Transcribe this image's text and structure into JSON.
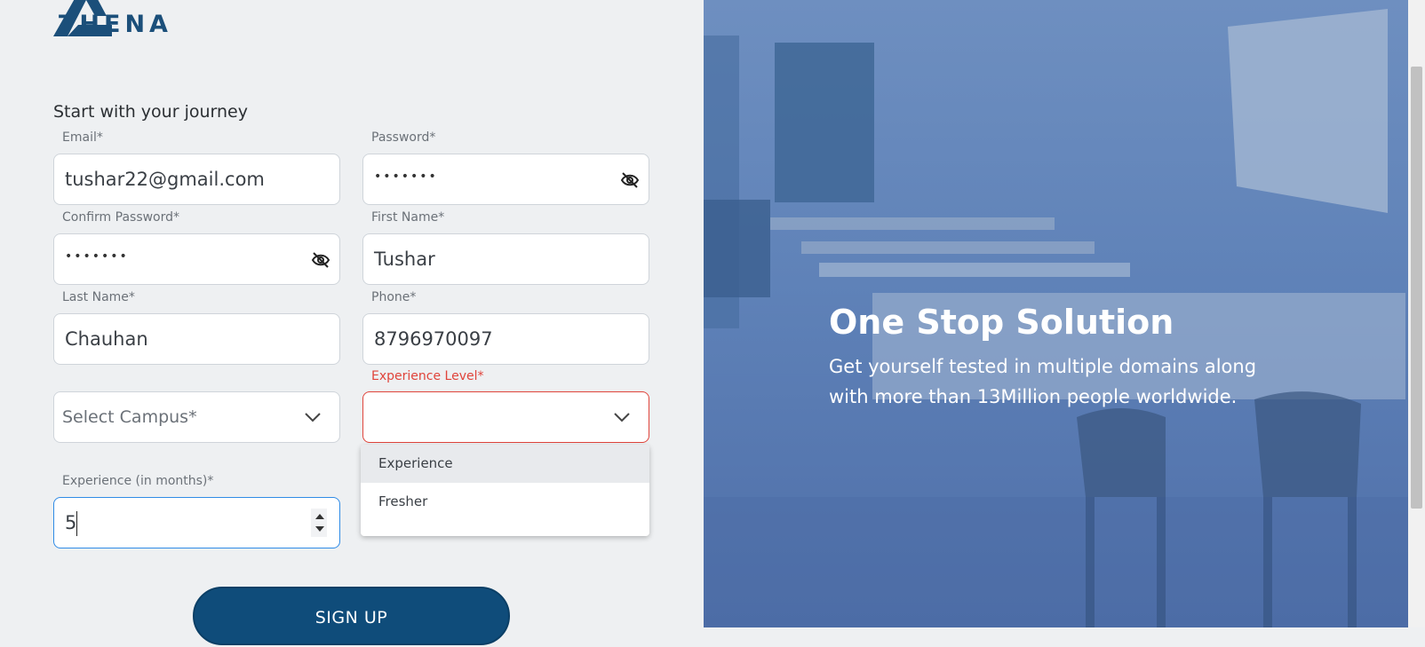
{
  "brand": {
    "logo_text": "THENA"
  },
  "form": {
    "heading": "Start with your journey",
    "email": {
      "label": "Email*",
      "value": "tushar22@gmail.com"
    },
    "password": {
      "label": "Password*",
      "masked": "•••••••"
    },
    "confirm_password": {
      "label": "Confirm Password*",
      "masked": "•••••••"
    },
    "first_name": {
      "label": "First Name*",
      "value": "Tushar"
    },
    "last_name": {
      "label": "Last Name*",
      "value": "Chauhan"
    },
    "phone": {
      "label": "Phone*",
      "value": "8796970097"
    },
    "campus": {
      "placeholder": "Select Campus*"
    },
    "experience_level": {
      "label": "Experience Level*",
      "value": "",
      "options": [
        "Experience",
        "Fresher"
      ]
    },
    "experience_months": {
      "label": "Experience (in months)*",
      "value": "5"
    },
    "submit_label": "SIGN UP"
  },
  "hero": {
    "title": "One Stop Solution",
    "subtitle": "Get yourself tested in multiple domains along with more than 13Million people worldwide."
  },
  "colors": {
    "primary": "#0f4c7a",
    "error": "#e0443b",
    "focus": "#2f8be6",
    "hero_overlay": "#5f82b8"
  },
  "icons": [
    "eye-slash-icon",
    "chevron-down-icon",
    "spinner-arrows-icon"
  ]
}
